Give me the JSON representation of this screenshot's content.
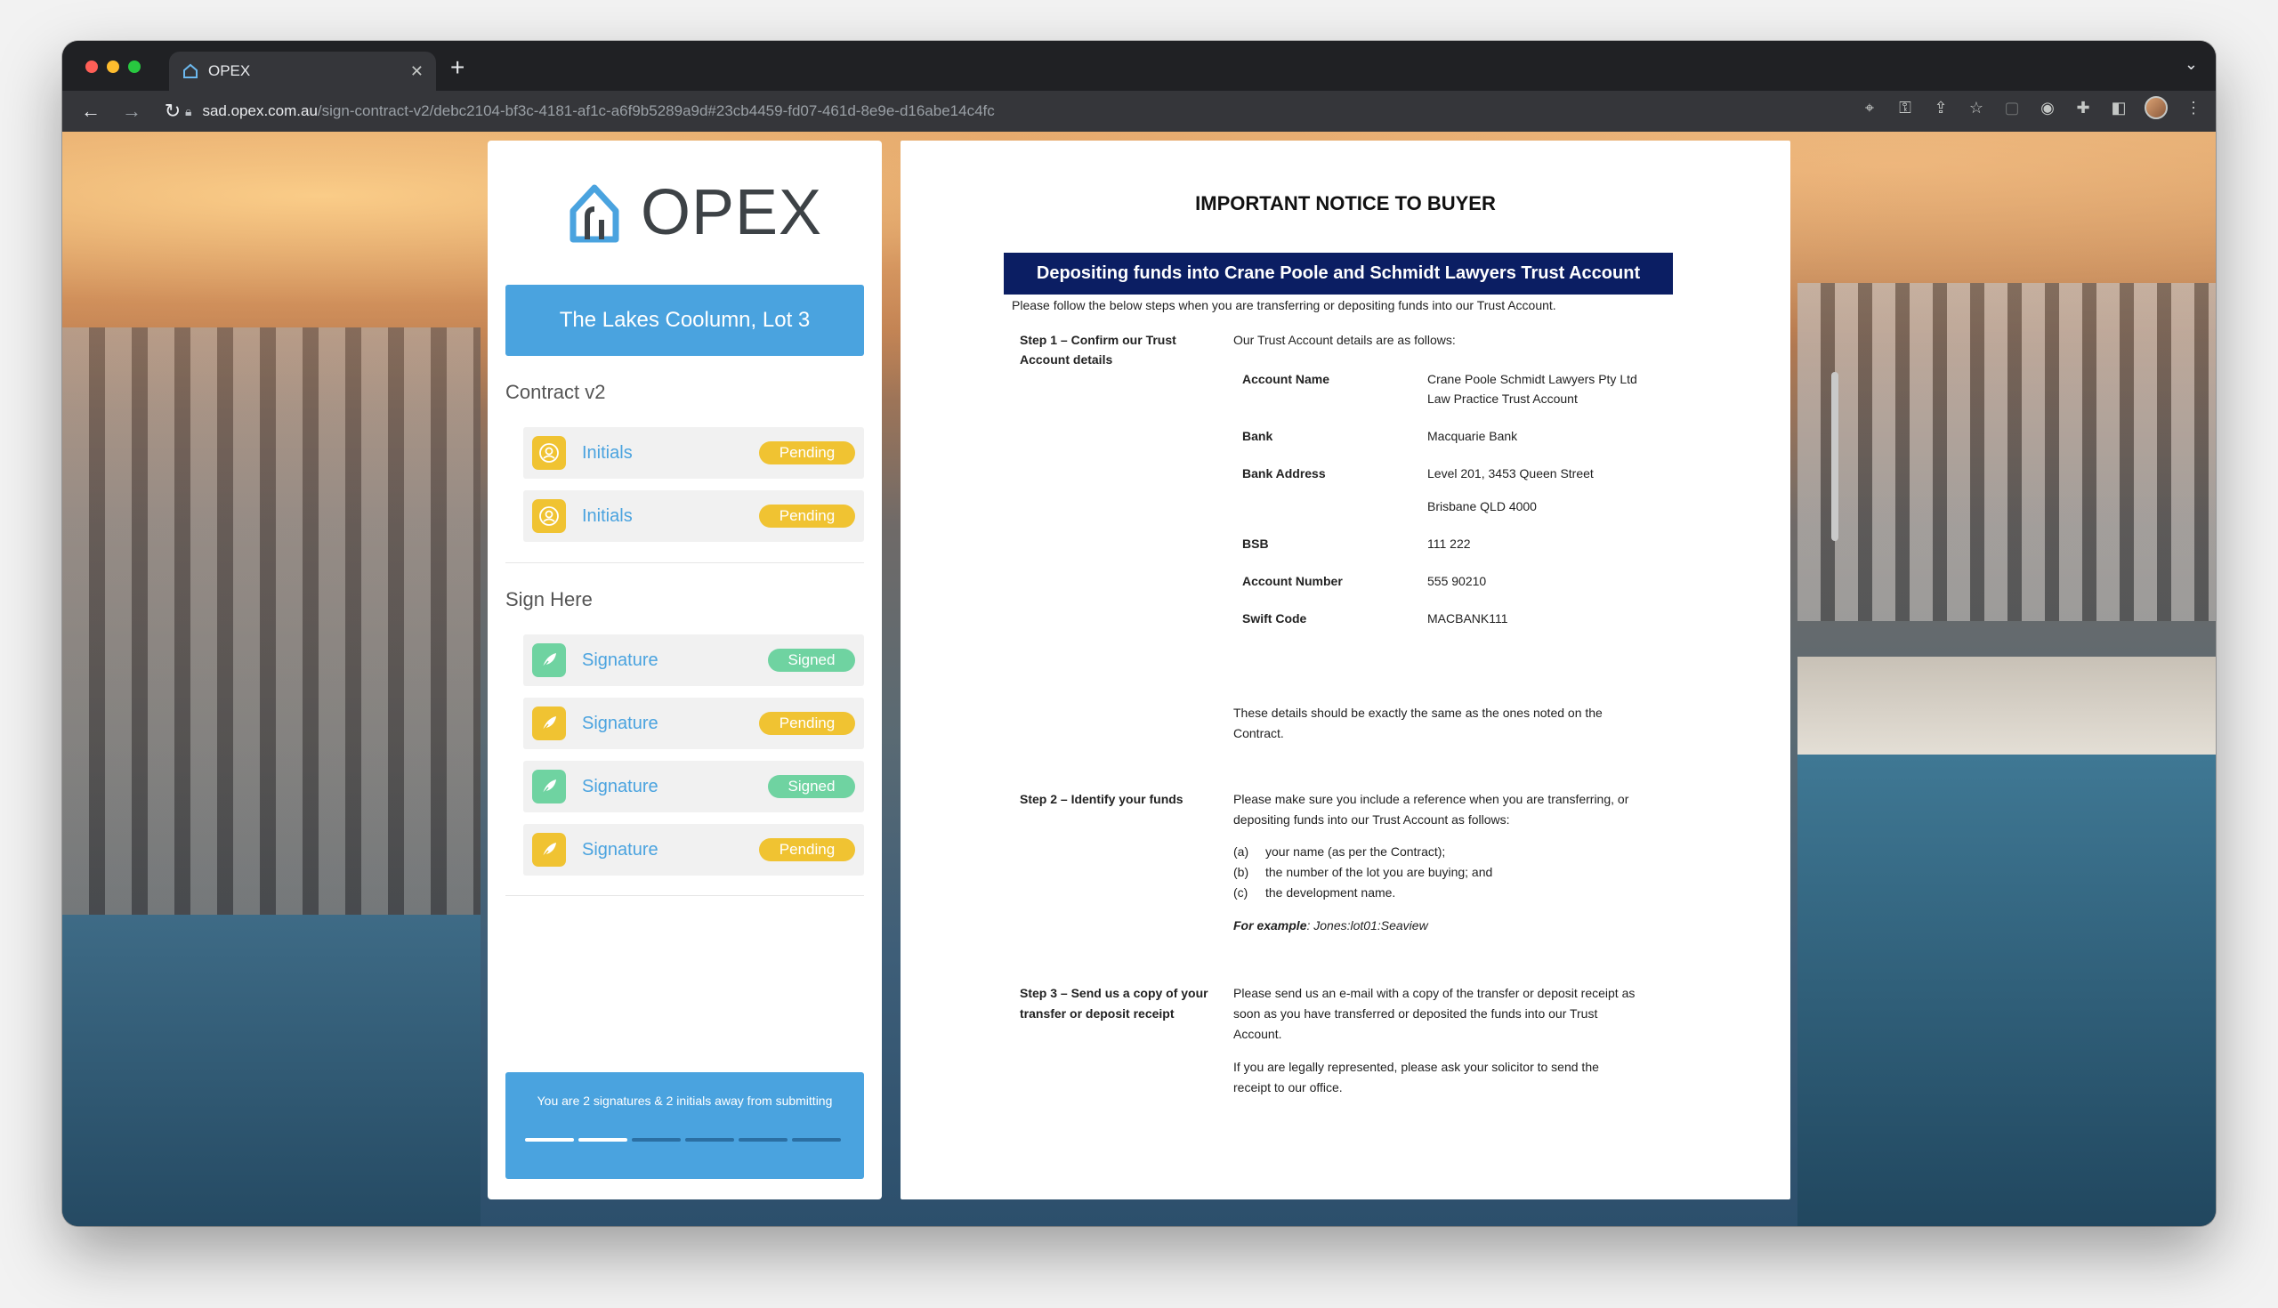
{
  "browser": {
    "tab_title": "OPEX",
    "tab_close": "✕",
    "new_tab": "+",
    "url_host": "sad.opex.com.au",
    "url_path": "/sign-contract-v2/debc2104-bf3c-4181-af1c-a6f9b5289a9d#23cb4459-fd07-461d-8e9e-d16abe14c4fc"
  },
  "sidebar": {
    "logo_text": "OPEX",
    "project_name": "The Lakes Coolumn, Lot 3",
    "contract_title": "Contract v2",
    "initials": [
      {
        "label": "Initials",
        "status": "Pending"
      },
      {
        "label": "Initials",
        "status": "Pending"
      }
    ],
    "sign_title": "Sign Here",
    "signatures": [
      {
        "label": "Signature",
        "status": "Signed"
      },
      {
        "label": "Signature",
        "status": "Pending"
      },
      {
        "label": "Signature",
        "status": "Signed"
      },
      {
        "label": "Signature",
        "status": "Pending"
      }
    ],
    "progress_message": "You are 2 signatures & 2 initials away from submitting",
    "progress_completed": 2,
    "progress_total": 6
  },
  "colors": {
    "accent": "#4aa3df",
    "pending": "#f0c332",
    "signed": "#6fd3a1",
    "banner": "#0b1e63"
  },
  "document": {
    "heading": "IMPORTANT NOTICE TO BUYER",
    "banner": "Depositing funds into Crane Poole and Schmidt Lawyers Trust Account",
    "intro": "Please follow the below steps when you are transferring or depositing funds into our Trust Account.",
    "step1_title_1": "Step 1 – Confirm our Trust",
    "step1_title_2": "Account details",
    "step1_intro": "Our Trust Account details are as follows:",
    "account_name_label": "Account Name",
    "account_name_1": "Crane Poole Schmidt Lawyers Pty Ltd",
    "account_name_2": "Law Practice Trust Account",
    "bank_label": "Bank",
    "bank": "Macquarie Bank",
    "bank_address_label": "Bank Address",
    "bank_address_1": "Level 201, 3453 Queen Street",
    "bank_address_2": "Brisbane QLD 4000",
    "bsb_label": "BSB",
    "bsb": "111 222",
    "account_number_label": "Account Number",
    "account_number": "555 90210",
    "swift_label": "Swift Code",
    "swift": "MACBANK111",
    "step1_note_1": "These details should be exactly the same as the ones noted on the",
    "step1_note_2": "Contract.",
    "step2_title": "Step 2 – Identify your funds",
    "step2_text_1": "Please make sure you include a reference when you are transferring, or",
    "step2_text_2": "depositing funds into our Trust Account as follows:",
    "list_a_key": "(a)",
    "list_a": "your name (as per the Contract);",
    "list_b_key": "(b)",
    "list_b": "the number of the lot you are buying; and",
    "list_c_key": "(c)",
    "list_c": "the development name.",
    "example_label": "For example",
    "example_value": ": Jones:lot01:Seaview",
    "step3_title_1": "Step 3 – Send us a copy of your",
    "step3_title_2": "transfer or deposit receipt",
    "step3_text_1": "Please send us an e-mail with a copy of the transfer or deposit receipt as",
    "step3_text_2": "soon as you have transferred or deposited the funds into our Trust",
    "step3_text_3": "Account.",
    "step3_text_4": "If you are legally represented, please ask your solicitor to send the",
    "step3_text_5": "receipt to our office."
  }
}
